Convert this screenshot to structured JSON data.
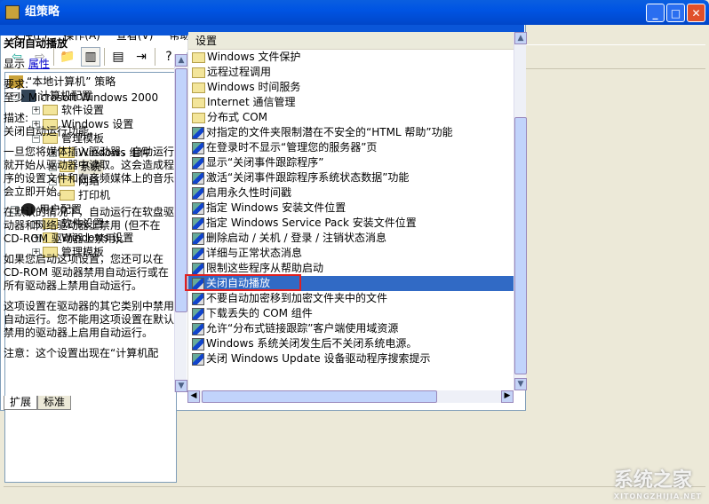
{
  "window": {
    "title": "组策略"
  },
  "menu": [
    "文件(F)",
    "操作(A)",
    "查看(V)",
    "帮助(H)"
  ],
  "tree": {
    "root": "“本地计算机” 策略",
    "computer": "计算机配置",
    "computer_children": [
      "软件设置",
      "Windows 设置",
      "管理模板"
    ],
    "admin_children": [
      "Windows 组件",
      "系统",
      "网络",
      "打印机"
    ],
    "user": "用户配置",
    "user_children": [
      "软件设置",
      "Windows 设置",
      "管理模板"
    ]
  },
  "header": {
    "title": "系统"
  },
  "description": {
    "title": "关闭自动播放",
    "show_label": "显示",
    "properties_link": "属性",
    "req_label": "要求:",
    "req_value": "至少 Microsoft Windows 2000",
    "desc_label": "描述:",
    "desc_value": "关闭自动运行功能。",
    "para1": "一旦您将媒体插入驱动器，自动运行就开始从驱动器中读取。这会造成程序的设置文件和在音频媒体上的音乐会立即开始。",
    "para2": "在默认的情况下，自动运行在软盘驱动器和网络驱动器上禁用 (但不在 CD-ROM 驱动器上禁用)。",
    "para3": "如果您启动这项设置，您还可以在 CD-ROM 驱动器禁用自动运行或在所有驱动器上禁用自动运行。",
    "para4": "这项设置在驱动器的其它类别中禁用自动运行。您不能用这项设置在默认禁用的驱动器上启用自动运行。",
    "para5": "注意：这个设置出现在“计算机配"
  },
  "list": {
    "header": "设置",
    "folders": [
      "Windows 文件保护",
      "远程过程调用",
      "Windows 时间服务",
      "Internet 通信管理",
      "分布式 COM"
    ],
    "settings": [
      "对指定的文件夹限制潜在不安全的“HTML 帮助”功能",
      "在登录时不显示“管理您的服务器”页",
      "显示“关闭事件跟踪程序”",
      "激活“关闭事件跟踪程序系统状态数据”功能",
      "启用永久性时间戳",
      "指定 Windows 安装文件位置",
      "指定 Windows Service Pack 安装文件位置",
      "删除启动 / 关机 / 登录 / 注销状态消息",
      "详细与正常状态消息",
      "限制这些程序从帮助启动",
      "关闭自动播放",
      "不要自动加密移到加密文件夹中的文件",
      "下载丢失的 COM 组件",
      "允许“分布式链接跟踪”客户端使用域资源",
      "Windows 系统关闭发生后不关闭系统电源。",
      "关闭 Windows Update 设备驱动程序搜索提示"
    ],
    "selected_index": 10
  },
  "tabs": [
    "扩展",
    "标准"
  ],
  "watermark": {
    "text": "系统之家",
    "sub": "XITONGZHIJIA.NET"
  }
}
